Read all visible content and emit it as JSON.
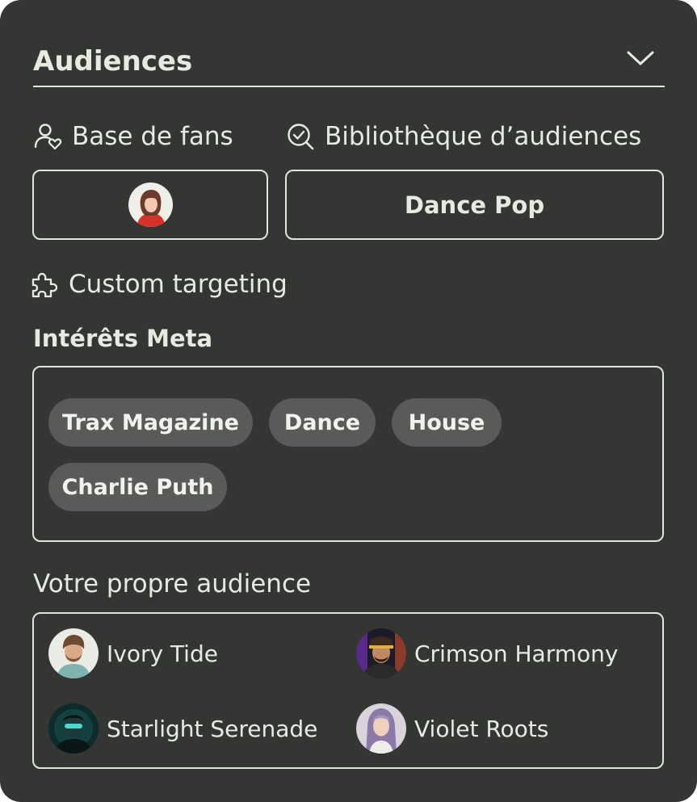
{
  "panel": {
    "title": "Audiences",
    "expand_icon": "chevron-down-icon"
  },
  "sources": {
    "fan_base": {
      "label": "Base de fans",
      "icon": "user-heart-icon"
    },
    "audience_library": {
      "label": "Bibliothèque d’audiences",
      "icon": "search-check-icon",
      "selected": "Dance Pop"
    }
  },
  "custom_targeting": {
    "label": "Custom targeting",
    "icon": "puzzle-icon"
  },
  "meta_interests": {
    "heading": "Intérêts Meta",
    "chips": [
      "Trax Magazine",
      "Dance",
      "House",
      "Charlie Puth"
    ]
  },
  "own_audience": {
    "heading": "Votre propre audience",
    "artists": [
      "Ivory Tide",
      "Crimson Harmony",
      "Starlight Serenade",
      "Violet Roots"
    ]
  },
  "colors": {
    "panel_bg": "#343633",
    "border": "#dfe6dc",
    "chip_bg": "#585b57",
    "text": "#e6ebe0"
  }
}
